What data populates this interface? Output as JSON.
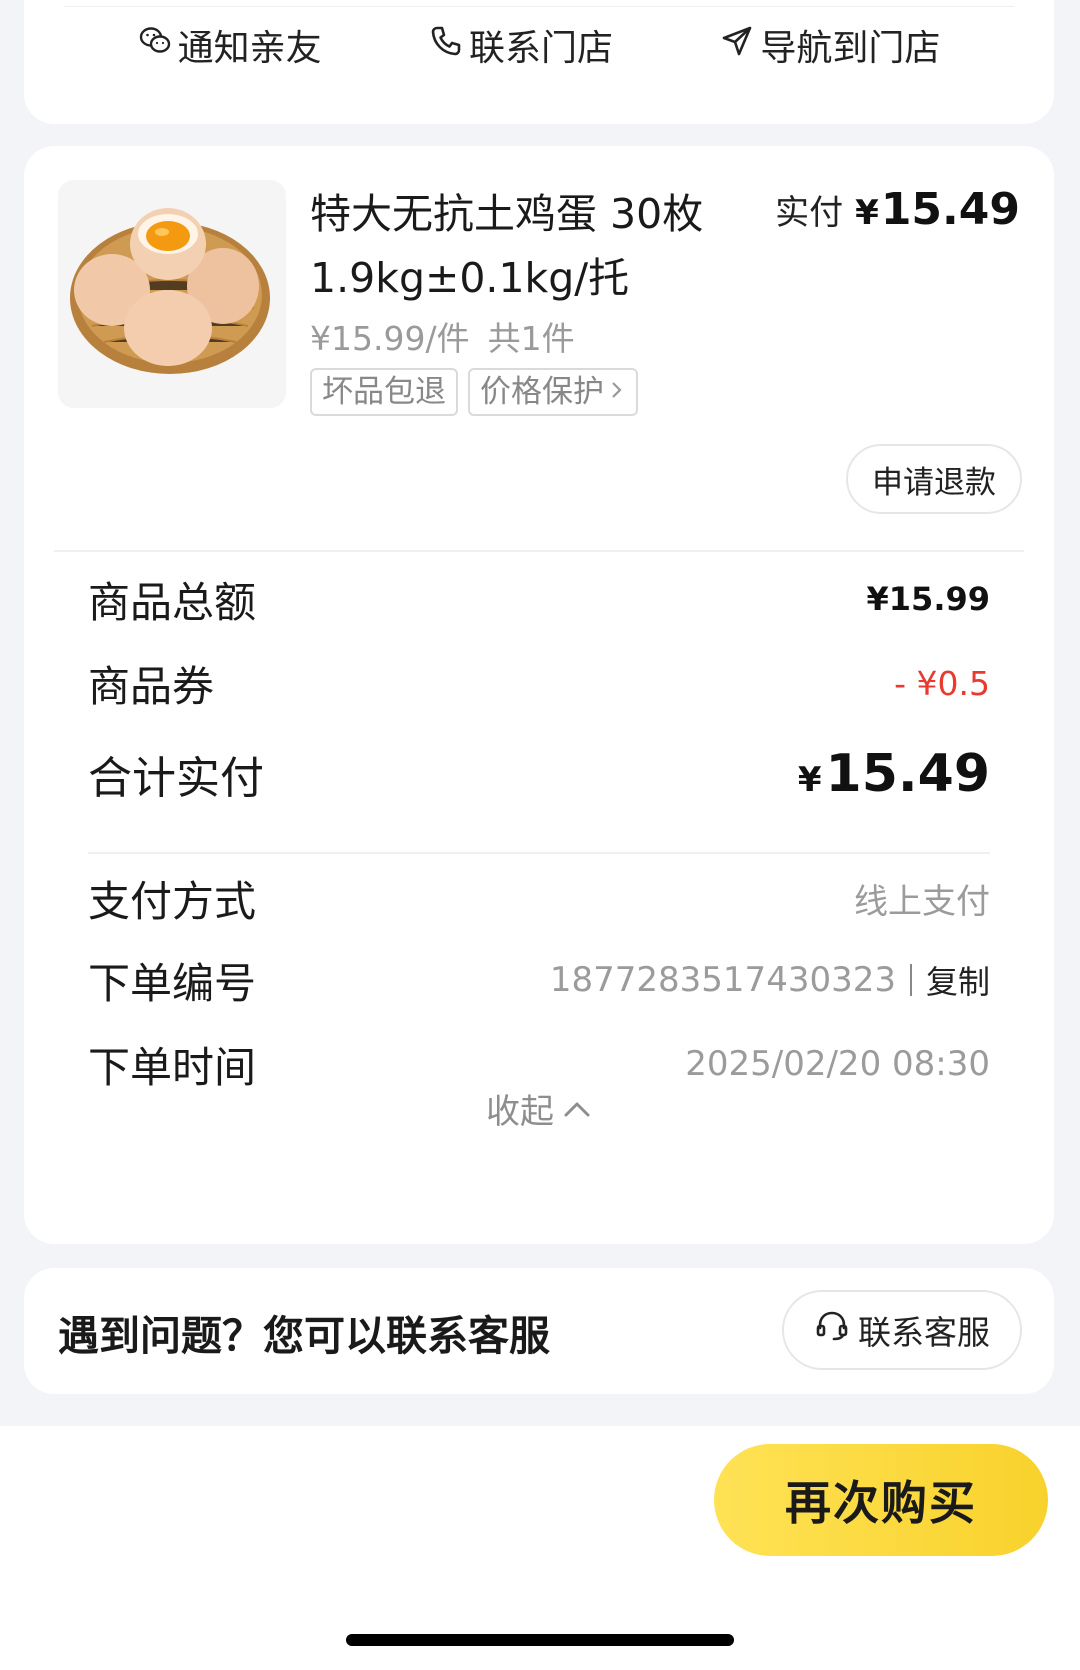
{
  "actions": [
    {
      "label": "通知亲友",
      "icon": "wechat-icon"
    },
    {
      "label": "联系门店",
      "icon": "phone-icon"
    },
    {
      "label": "导航到门店",
      "icon": "navigation-icon"
    }
  ],
  "product": {
    "title": "特大无抗土鸡蛋 30枚 1.9kg±0.1kg/托",
    "paid_label": "实付",
    "paid_currency": "¥",
    "paid_amount": "15.49",
    "unit_price": "¥15.99/件",
    "count": "共1件",
    "tags": [
      "坏品包退",
      "价格保护"
    ],
    "refund_label": "申请退款",
    "image_icon": "egg-basket-image"
  },
  "summary": {
    "goods_total_label": "商品总额",
    "goods_total_value": "¥15.99",
    "coupon_label": "商品券",
    "coupon_value": "- ¥0.5",
    "sum_label": "合计实付",
    "sum_currency": "¥",
    "sum_value": "15.49"
  },
  "details": {
    "pay_method_label": "支付方式",
    "pay_method_value": "线上支付",
    "order_no_label": "下单编号",
    "order_no_value": "1877283517430323",
    "copy_label": "复制",
    "order_time_label": "下单时间",
    "order_time_value": "2025/02/20 08:30",
    "collapse_label": "收起"
  },
  "help": {
    "text": "遇到问题？您可以联系客服",
    "cs_label": "联系客服"
  },
  "bottom": {
    "rebuy_label": "再次购买"
  },
  "colors": {
    "accent_yellow": "#f8d22c",
    "discount_red": "#ea3a2f"
  }
}
